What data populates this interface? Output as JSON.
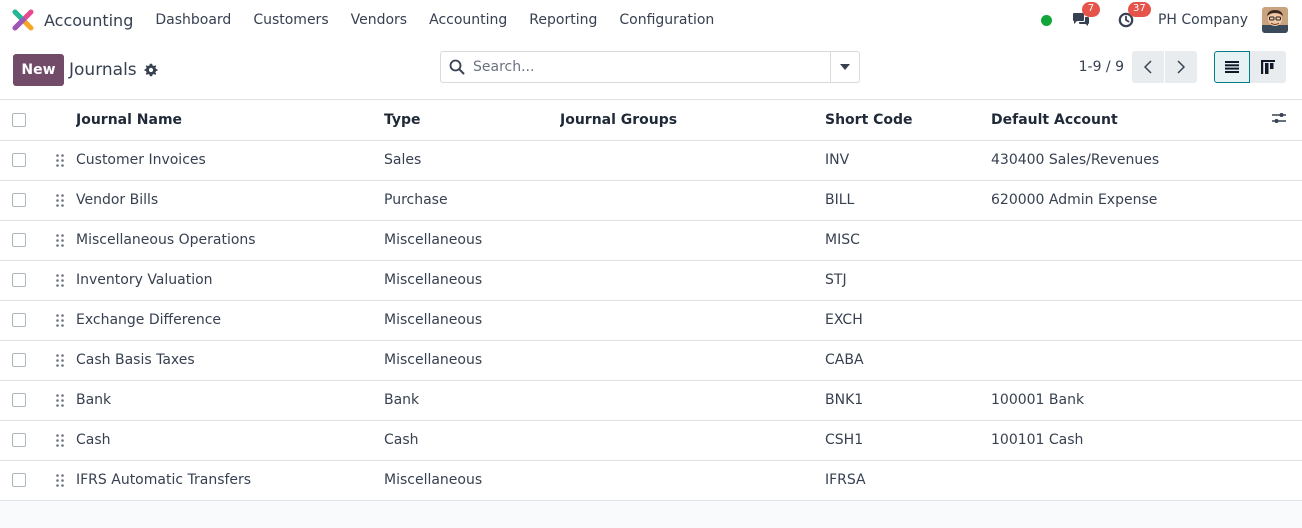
{
  "navbar": {
    "app_name": "Accounting",
    "menu": [
      "Dashboard",
      "Customers",
      "Vendors",
      "Accounting",
      "Reporting",
      "Configuration"
    ],
    "messages_count": "7",
    "activities_count": "37",
    "company": "PH Company"
  },
  "control": {
    "new_label": "New",
    "title": "Journals",
    "search_placeholder": "Search...",
    "pager": "1-9 / 9"
  },
  "table": {
    "columns": [
      "Journal Name",
      "Type",
      "Journal Groups",
      "Short Code",
      "Default Account"
    ],
    "rows": [
      {
        "name": "Customer Invoices",
        "type": "Sales",
        "groups": "",
        "code": "INV",
        "account": "430400 Sales/Revenues"
      },
      {
        "name": "Vendor Bills",
        "type": "Purchase",
        "groups": "",
        "code": "BILL",
        "account": "620000 Admin Expense"
      },
      {
        "name": "Miscellaneous Operations",
        "type": "Miscellaneous",
        "groups": "",
        "code": "MISC",
        "account": ""
      },
      {
        "name": "Inventory Valuation",
        "type": "Miscellaneous",
        "groups": "",
        "code": "STJ",
        "account": ""
      },
      {
        "name": "Exchange Difference",
        "type": "Miscellaneous",
        "groups": "",
        "code": "EXCH",
        "account": ""
      },
      {
        "name": "Cash Basis Taxes",
        "type": "Miscellaneous",
        "groups": "",
        "code": "CABA",
        "account": ""
      },
      {
        "name": "Bank",
        "type": "Bank",
        "groups": "",
        "code": "BNK1",
        "account": "100001 Bank"
      },
      {
        "name": "Cash",
        "type": "Cash",
        "groups": "",
        "code": "CSH1",
        "account": "100101 Cash"
      },
      {
        "name": "IFRS Automatic Transfers",
        "type": "Miscellaneous",
        "groups": "",
        "code": "IFRSA",
        "account": ""
      }
    ]
  },
  "colors": {
    "brand": "#714b67",
    "accent": "#017e84",
    "presence": "#12a63a",
    "badge": "#e5534b"
  },
  "icons": {
    "app": "accounting-logo-icon",
    "messages": "chat-bubbles-icon",
    "activities": "clock-icon",
    "settings": "gear-icon",
    "search": "magnifier-icon",
    "search_toggle": "caret-down-icon",
    "pager_prev": "chevron-left-icon",
    "pager_next": "chevron-right-icon",
    "list_view": "list-view-icon",
    "kanban_view": "kanban-view-icon",
    "optional_columns": "sliders-icon",
    "drag_handle": "drag-handle-icon"
  }
}
